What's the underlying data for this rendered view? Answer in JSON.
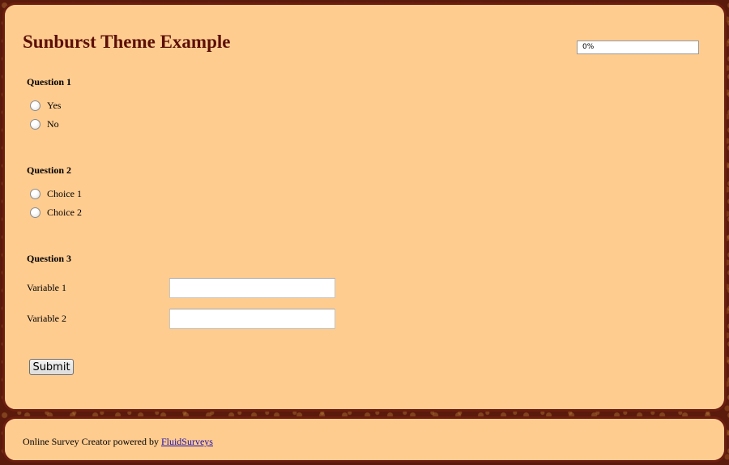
{
  "survey": {
    "title": "Sunburst Theme Example",
    "progress": {
      "text": "0%",
      "value": 0
    }
  },
  "questions": [
    {
      "title": "Question 1",
      "options": [
        "Yes",
        "No"
      ]
    },
    {
      "title": "Question 2",
      "options": [
        "Choice 1",
        "Choice 2"
      ]
    },
    {
      "title": "Question 3",
      "variables": [
        {
          "label": "Variable 1",
          "value": ""
        },
        {
          "label": "Variable 2",
          "value": ""
        }
      ]
    }
  ],
  "submit_label": "Submit",
  "footer": {
    "text": "Online Survey Creator powered by ",
    "link_text": "FluidSurveys"
  },
  "colors": {
    "panel_bg": "#ffcc90",
    "panel_border": "#6b1e10",
    "title": "#5c1008",
    "page_bg": "#5a1a0c"
  },
  "icons": {
    "radio": "radio-button-icon"
  }
}
